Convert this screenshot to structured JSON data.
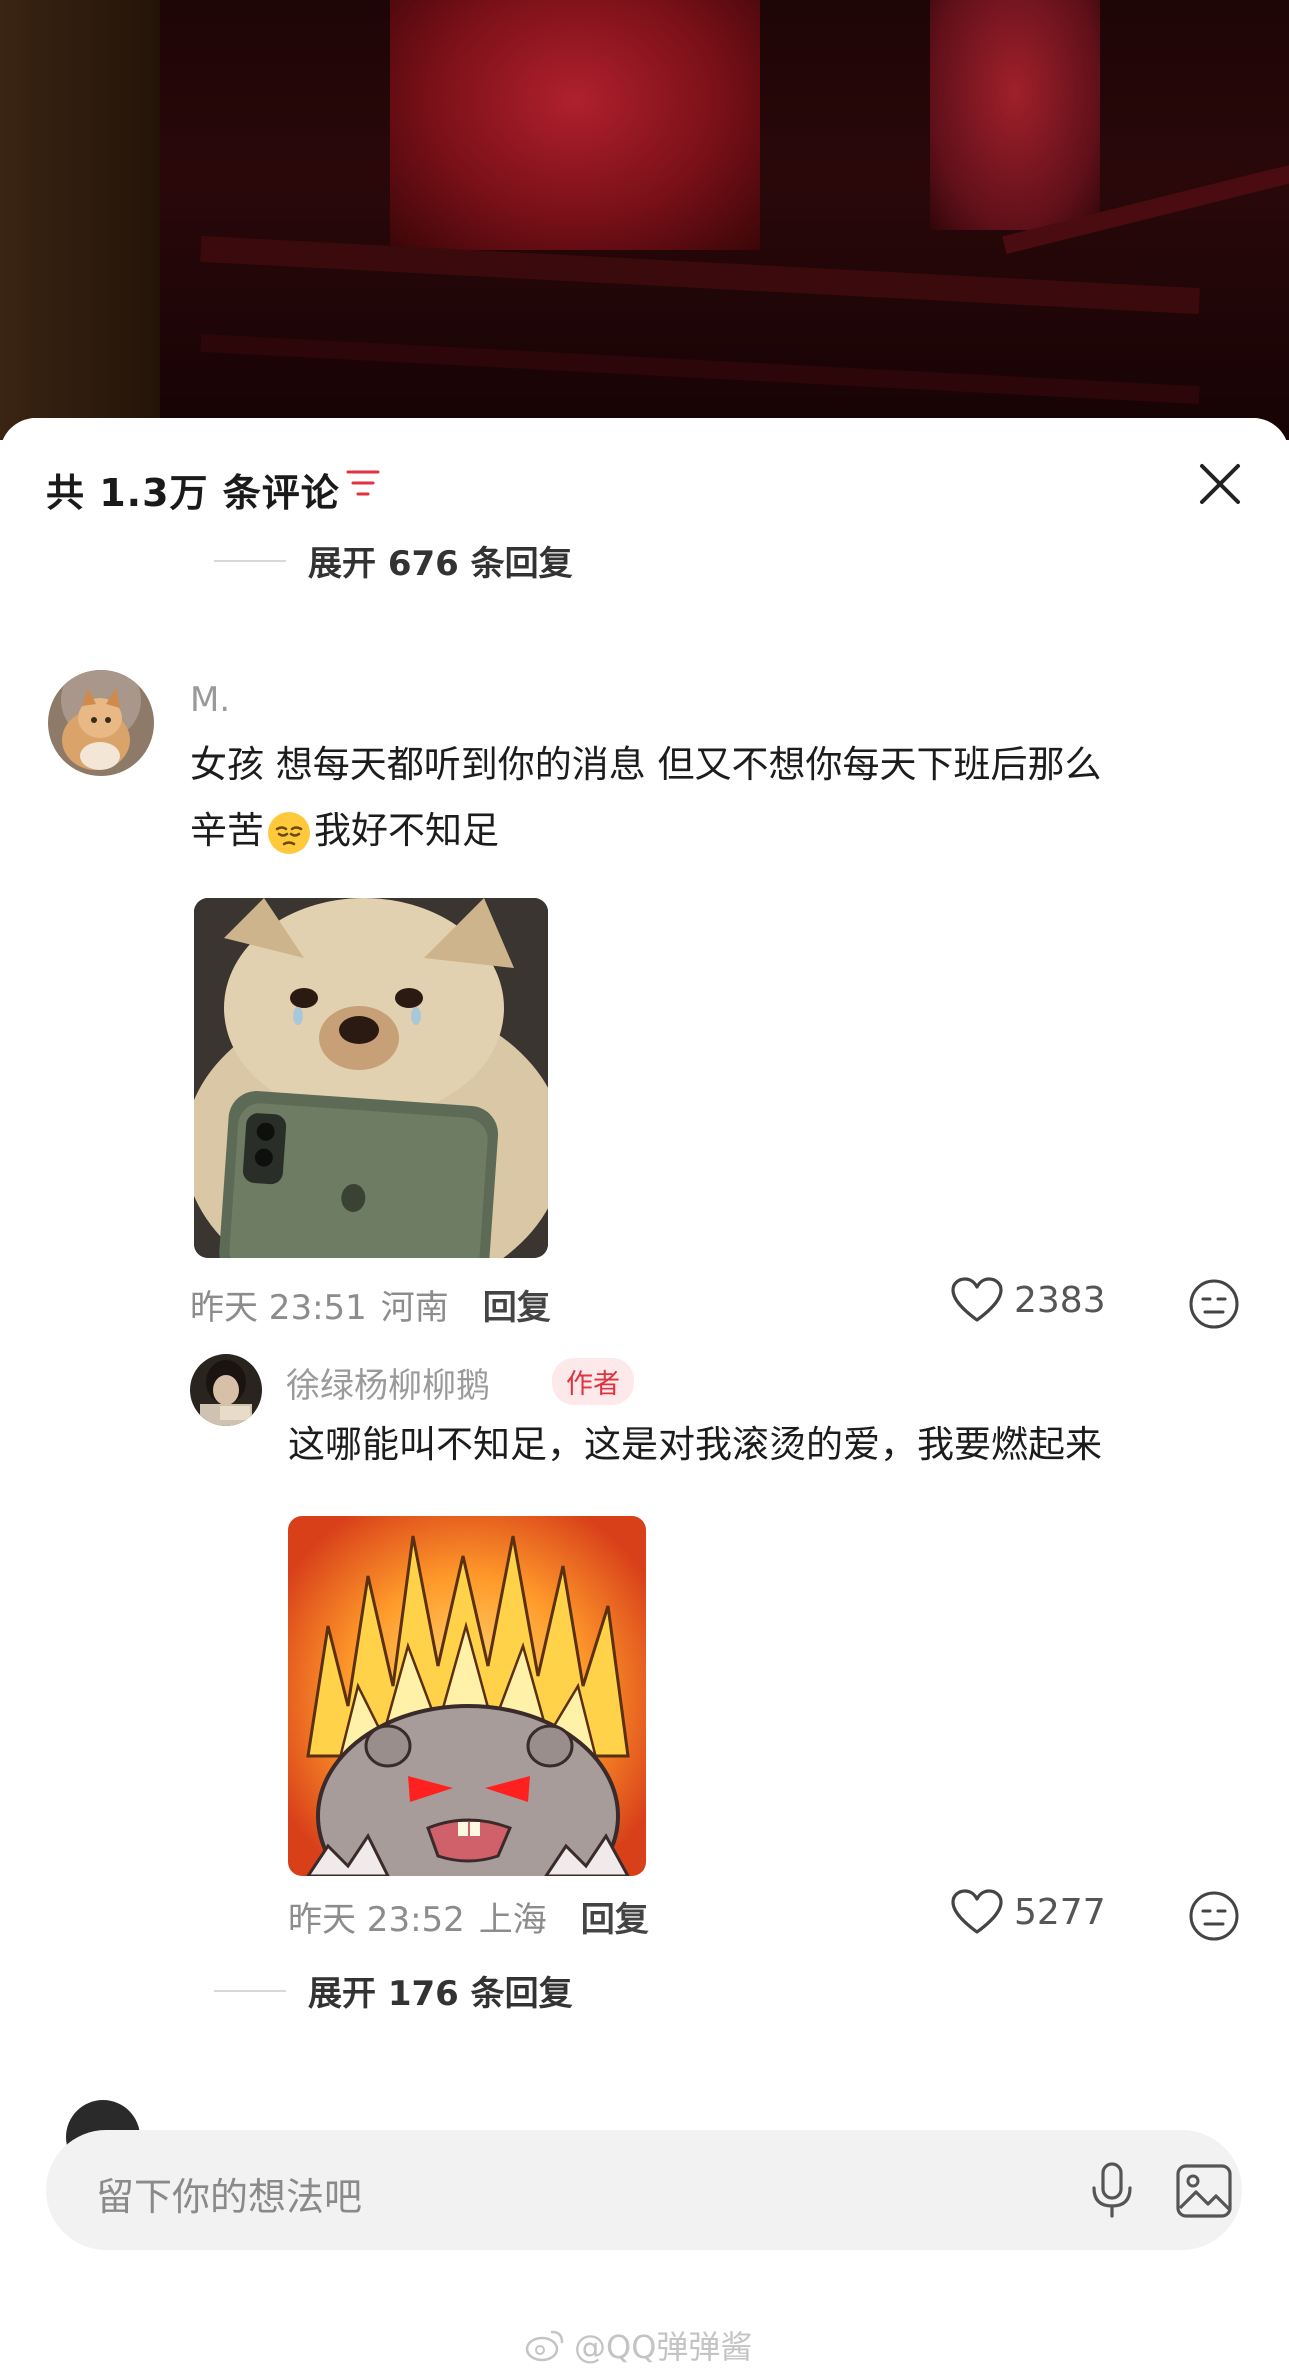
{
  "header": {
    "title": "共 1.3万 条评论"
  },
  "thread_top": {
    "expand_label": "展开 676 条回复"
  },
  "comment": {
    "username": "M.",
    "text_line1": "女孩 想每天都听到你的消息 但又不想你每天下班后那么",
    "text_line2_before": "辛苦",
    "text_line2_after": "我好不知足",
    "meta_time": "昨天 23:51",
    "meta_location": "河南",
    "reply_label": "回复",
    "likes": "2383"
  },
  "reply": {
    "username": "徐绿杨柳柳鹅",
    "badge": "作者",
    "text": "这哪能叫不知足，这是对我滚烫的爱，我要燃起来",
    "meta_time": "昨天 23:52",
    "meta_location": "上海",
    "reply_label": "回复",
    "likes": "5277"
  },
  "thread_bottom": {
    "expand_label": "展开 176 条回复"
  },
  "input": {
    "placeholder": "留下你的想法吧"
  },
  "watermark": {
    "text": "@QQ弹弹酱"
  },
  "colors": {
    "badge_text": "#e0323f",
    "badge_bg": "#fde8ea",
    "sort_icon": "#e0323f"
  }
}
